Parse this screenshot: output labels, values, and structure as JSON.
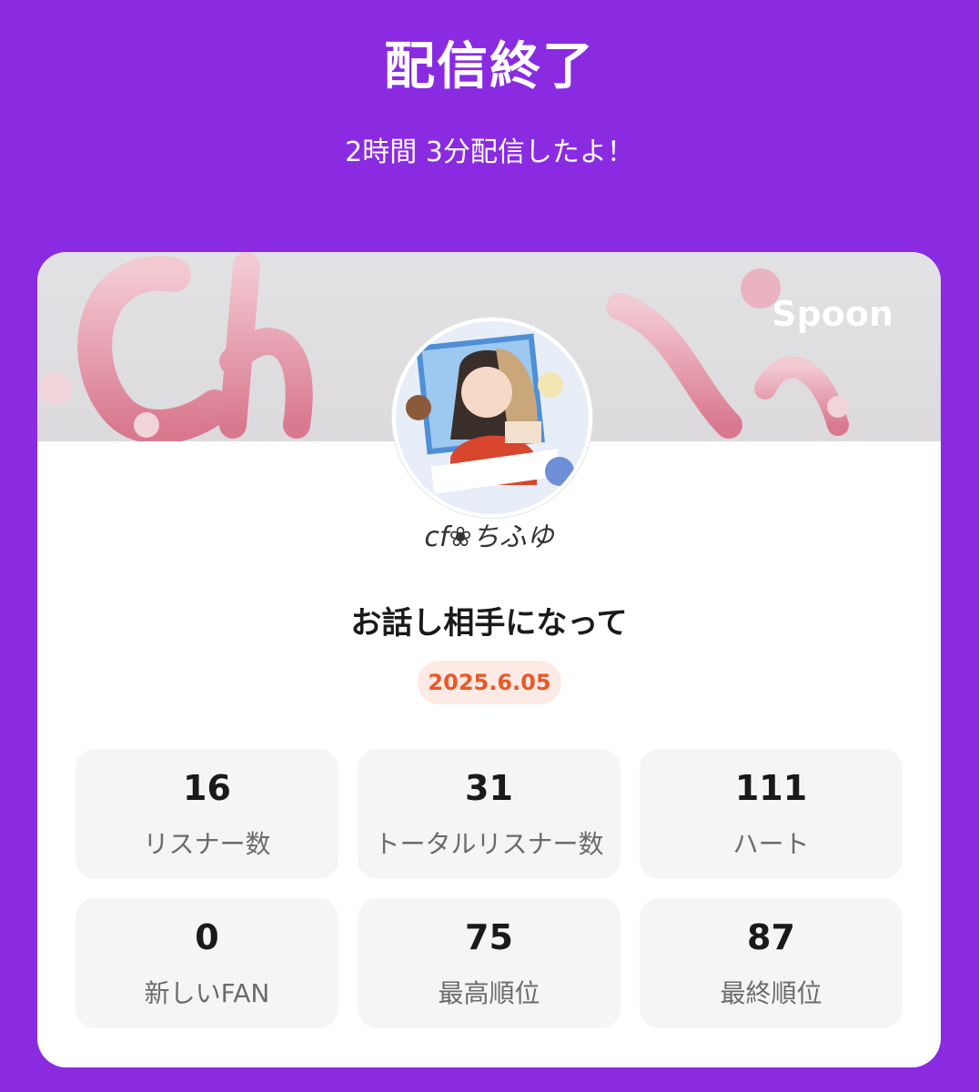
{
  "header": {
    "title": "配信終了",
    "subtitle": "2時間 3分配信したよ！"
  },
  "card": {
    "brand": "Spoon",
    "username": "cf❀ちふゆ",
    "live_title": "お話し相手になって",
    "date": "2025.6.05",
    "stats": [
      {
        "value": "16",
        "label": "リスナー数"
      },
      {
        "value": "31",
        "label": "トータルリスナー数"
      },
      {
        "value": "111",
        "label": "ハート"
      },
      {
        "value": "0",
        "label": "新しいFAN"
      },
      {
        "value": "75",
        "label": "最高順位"
      },
      {
        "value": "87",
        "label": "最終順位"
      }
    ]
  },
  "colors": {
    "background": "#8a2be2",
    "date_badge_bg": "#fdeae4",
    "date_badge_text": "#e8592a"
  }
}
